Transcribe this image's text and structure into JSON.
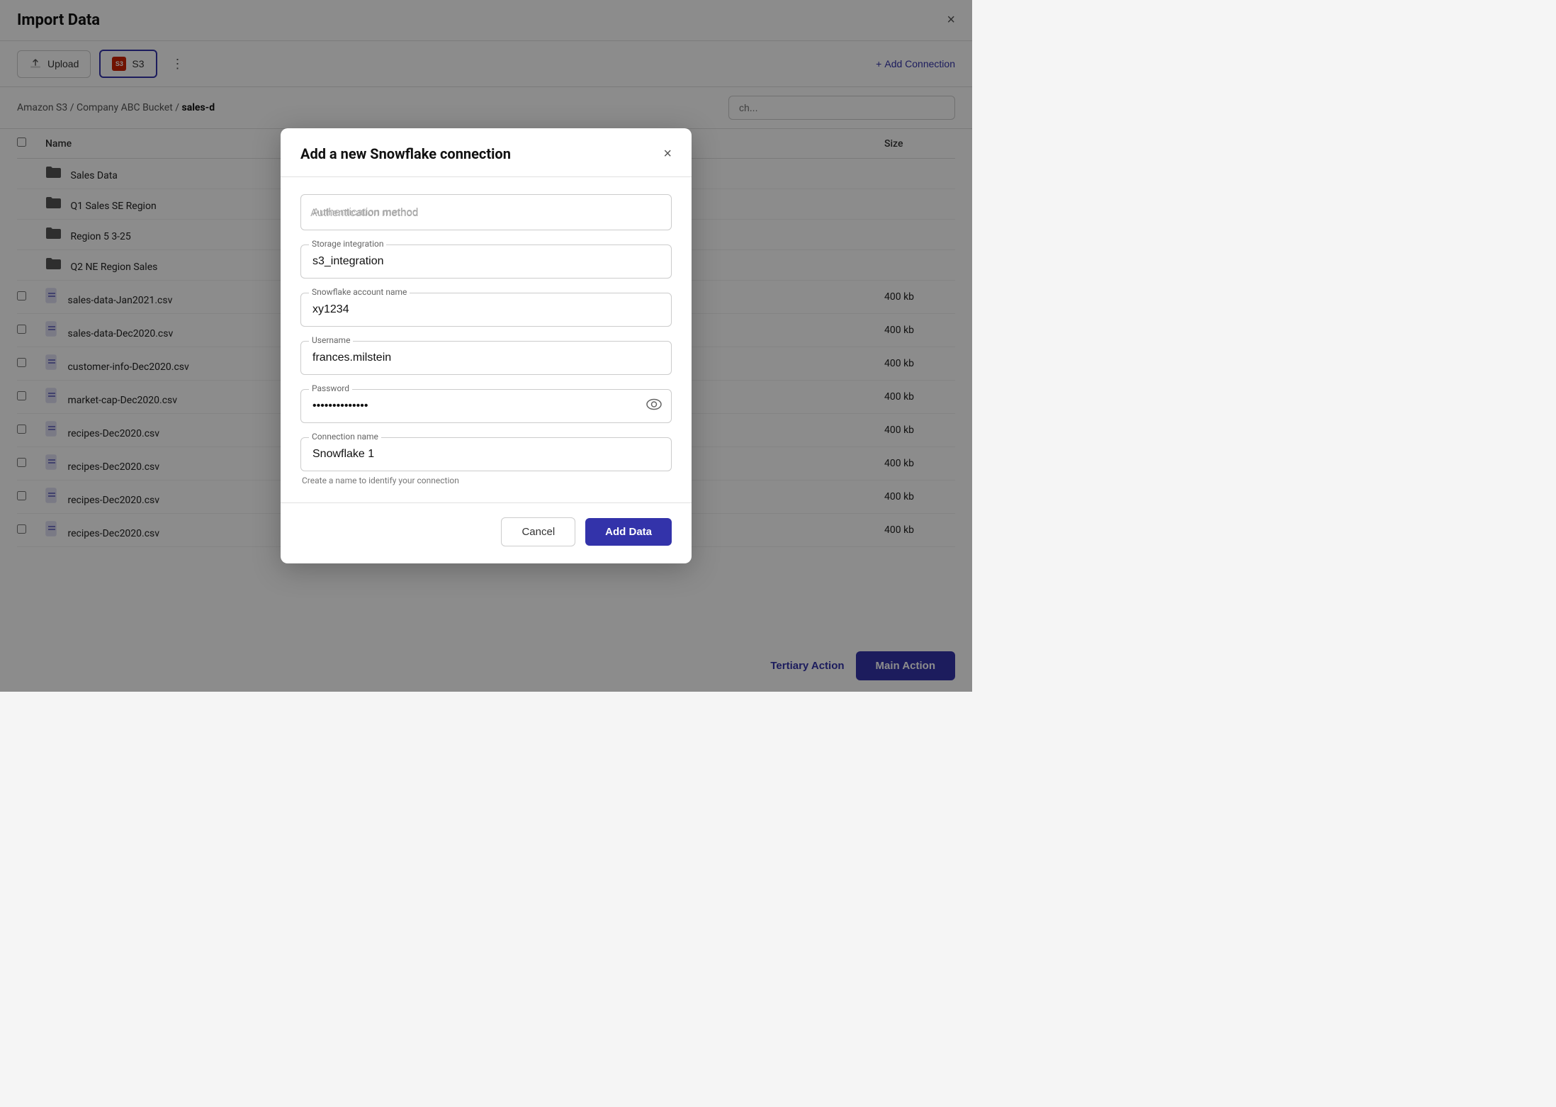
{
  "page": {
    "title": "Import Data",
    "close_label": "×"
  },
  "toolbar": {
    "upload_label": "Upload",
    "s3_label": "S3",
    "more_icon": "⋮",
    "add_connection_label": "Add Connection",
    "add_connection_prefix": "+"
  },
  "breadcrumb": {
    "path": "Amazon S3 / Company ABC Bucket / ",
    "current": "sales-d"
  },
  "search": {
    "placeholder": "ch..."
  },
  "table": {
    "col_name": "Name",
    "col_size": "Size",
    "folders": [
      {
        "name": "Sales Data"
      },
      {
        "name": "Q1 Sales SE Region"
      },
      {
        "name": "Region 5 3-25"
      },
      {
        "name": "Q2 NE Region Sales"
      }
    ],
    "files": [
      {
        "name": "sales-data-Jan2021.csv",
        "size": "400 kb"
      },
      {
        "name": "sales-data-Dec2020.csv",
        "size": "400 kb"
      },
      {
        "name": "customer-info-Dec2020.csv",
        "size": "400 kb"
      },
      {
        "name": "market-cap-Dec2020.csv",
        "size": "400 kb"
      },
      {
        "name": "recipes-Dec2020.csv",
        "size": "400 kb"
      },
      {
        "name": "recipes-Dec2020.csv",
        "size": "400 kb"
      },
      {
        "name": "recipes-Dec2020.csv",
        "size": "400 kb"
      },
      {
        "name": "recipes-Dec2020.csv",
        "size": "400 kb"
      }
    ]
  },
  "modal": {
    "title": "Add a new Snowflake connection",
    "close_label": "×",
    "auth_placeholder": "Authentication method",
    "storage_label": "Storage integration",
    "storage_value": "s3_integration",
    "account_label": "Snowflake account name",
    "account_value": "xy1234",
    "username_label": "Username",
    "username_value": "frances.milstein",
    "password_label": "Password",
    "password_value": "••••••••••••••",
    "eye_icon": "👁",
    "connection_name_label": "Connection name",
    "connection_name_value": "Snowflake 1",
    "connection_hint": "Create a name to identify your connection",
    "cancel_label": "Cancel",
    "add_data_label": "Add Data"
  },
  "bottom_bar": {
    "tertiary_label": "Tertiary Action",
    "main_label": "Main Action"
  },
  "colors": {
    "accent": "#3333aa",
    "danger": "#cc2200"
  }
}
